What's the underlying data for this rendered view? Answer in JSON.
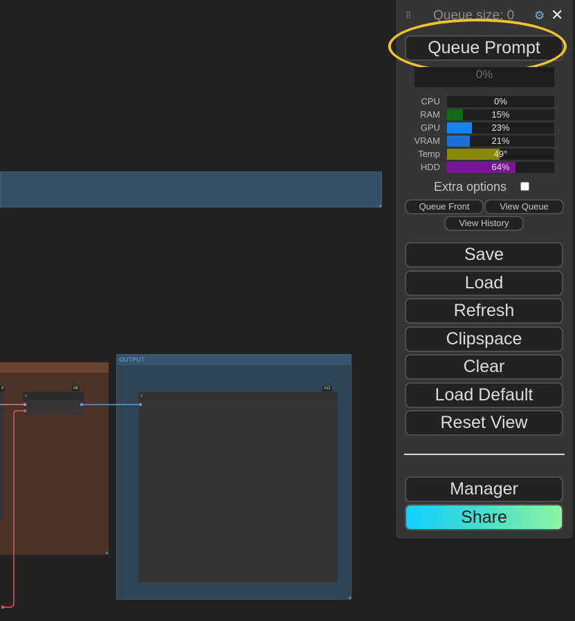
{
  "canvas": {
    "output_group_title": "OUTPUT",
    "badges": [
      "#",
      "#8",
      "#11"
    ]
  },
  "menu": {
    "queue_size": "Queue size: 0",
    "queue_prompt": "Queue Prompt",
    "progress": "0%",
    "stats": [
      {
        "label": "CPU",
        "value": "0%",
        "fraction": 0.0,
        "color": "#2e7d32"
      },
      {
        "label": "RAM",
        "value": "15%",
        "fraction": 0.15,
        "color": "#0f6b14"
      },
      {
        "label": "GPU",
        "value": "23%",
        "fraction": 0.23,
        "color": "#1683f0"
      },
      {
        "label": "VRAM",
        "value": "21%",
        "fraction": 0.21,
        "color": "#1c71d8"
      },
      {
        "label": "Temp",
        "value": "49°",
        "fraction": 0.49,
        "color": "#8a8a00"
      },
      {
        "label": "HDD",
        "value": "64%",
        "fraction": 0.64,
        "color": "#7a1597"
      }
    ],
    "extra_options": "Extra options",
    "queue_front": "Queue Front",
    "view_queue": "View Queue",
    "view_history": "View History",
    "buttons": {
      "save": "Save",
      "load": "Load",
      "refresh": "Refresh",
      "clipspace": "Clipspace",
      "clear": "Clear",
      "load_default": "Load Default",
      "reset_view": "Reset View",
      "manager": "Manager",
      "share": "Share"
    }
  }
}
